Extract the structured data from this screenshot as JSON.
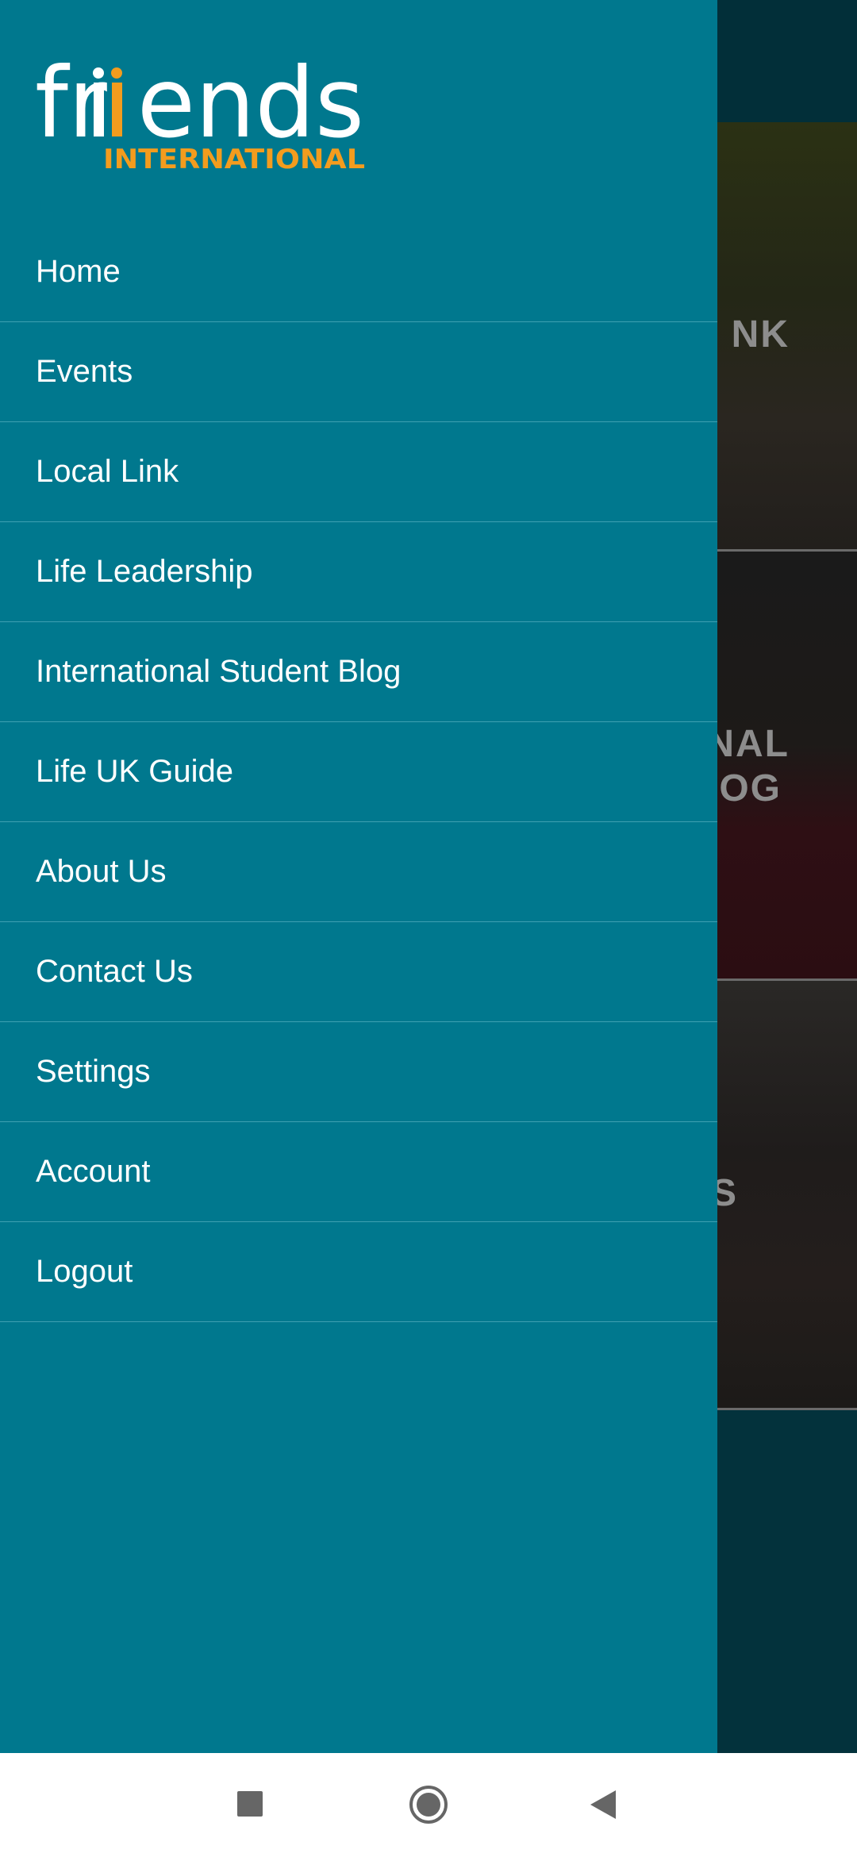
{
  "logo": {
    "word": "friends",
    "sub": "INTERNATIONAL",
    "colors": {
      "word": "#ffffff",
      "accent": "#f39c1e"
    }
  },
  "menu": [
    {
      "label": "Home"
    },
    {
      "label": "Events"
    },
    {
      "label": "Local Link"
    },
    {
      "label": "Life Leadership"
    },
    {
      "label": "International Student Blog"
    },
    {
      "label": "Life UK Guide"
    },
    {
      "label": "About Us"
    },
    {
      "label": "Contact Us"
    },
    {
      "label": "Settings"
    },
    {
      "label": "Account"
    },
    {
      "label": "Logout"
    }
  ],
  "background_cards": [
    {
      "text_lines": [
        "NK"
      ]
    },
    {
      "text_lines": [
        "NAL",
        "LOG"
      ]
    },
    {
      "text_lines": [
        "S"
      ]
    }
  ],
  "colors": {
    "drawer": "#00788e",
    "divider": "#3fa0b2",
    "scrim": "#022f39"
  },
  "navbar": {
    "icons": [
      "recents-square-icon",
      "home-circle-icon",
      "back-triangle-icon"
    ]
  }
}
